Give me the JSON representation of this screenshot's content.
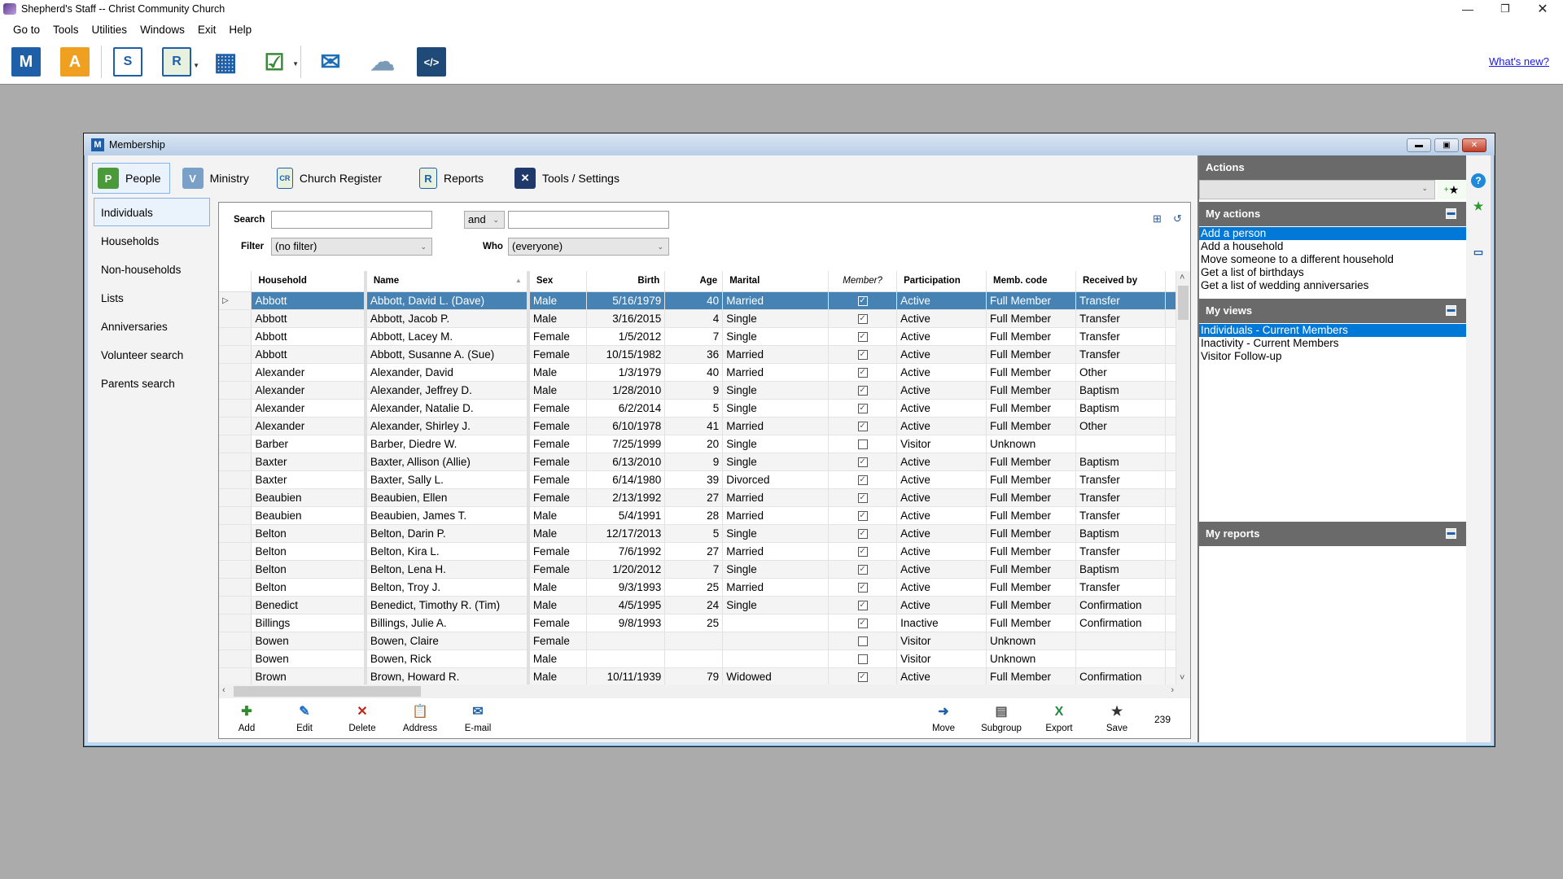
{
  "app": {
    "title": "Shepherd's Staff -- Christ Community Church",
    "menu": [
      "Go to",
      "Tools",
      "Utilities",
      "Windows",
      "Exit",
      "Help"
    ],
    "whats_new": "What's new?",
    "toolbar": [
      {
        "icon": "membership-icon",
        "glyph": "M"
      },
      {
        "icon": "attendance-icon",
        "glyph": "A"
      },
      {
        "icon": "staff-icon",
        "glyph": "S"
      },
      {
        "icon": "reports-icon",
        "glyph": "R"
      },
      {
        "icon": "calendar-icon",
        "glyph": "▦"
      },
      {
        "icon": "tasks-icon",
        "glyph": "☑"
      },
      {
        "icon": "email-icon",
        "glyph": "✉"
      },
      {
        "icon": "cloud-alert-icon",
        "glyph": "☁"
      },
      {
        "icon": "code-icon",
        "glyph": "</>"
      }
    ]
  },
  "membership": {
    "title": "Membership",
    "tabs": [
      {
        "label": "People",
        "glyph": "P",
        "active": true
      },
      {
        "label": "Ministry",
        "glyph": "V"
      },
      {
        "label": "Church Register",
        "glyph": "CR"
      },
      {
        "label": "Reports",
        "glyph": "R"
      },
      {
        "label": "Tools / Settings",
        "glyph": "✕"
      }
    ],
    "nav": [
      "Individuals",
      "Households",
      "Non-households",
      "Lists",
      "Anniversaries",
      "Volunteer search",
      "Parents search"
    ],
    "nav_active": 0,
    "search": {
      "search_label": "Search",
      "search_value": "",
      "conjunction": "and",
      "search2_value": "",
      "filter_label": "Filter",
      "filter_value": "(no filter)",
      "who_label": "Who",
      "who_value": "(everyone)"
    },
    "columns": [
      "Household",
      "Name",
      "Sex",
      "Birth",
      "Age",
      "Marital",
      "Member?",
      "Participation",
      "Memb. code",
      "Received by"
    ],
    "rows": [
      [
        "Abbott",
        "Abbott, David L. (Dave)",
        "Male",
        "5/16/1979",
        "40",
        "Married",
        true,
        "Active",
        "Full Member",
        "Transfer"
      ],
      [
        "Abbott",
        "Abbott, Jacob P.",
        "Male",
        "3/16/2015",
        "4",
        "Single",
        true,
        "Active",
        "Full Member",
        "Transfer"
      ],
      [
        "Abbott",
        "Abbott, Lacey M.",
        "Female",
        "1/5/2012",
        "7",
        "Single",
        true,
        "Active",
        "Full Member",
        "Transfer"
      ],
      [
        "Abbott",
        "Abbott, Susanne A. (Sue)",
        "Female",
        "10/15/1982",
        "36",
        "Married",
        true,
        "Active",
        "Full Member",
        "Transfer"
      ],
      [
        "Alexander",
        "Alexander, David",
        "Male",
        "1/3/1979",
        "40",
        "Married",
        true,
        "Active",
        "Full Member",
        "Other"
      ],
      [
        "Alexander",
        "Alexander, Jeffrey D.",
        "Male",
        "1/28/2010",
        "9",
        "Single",
        true,
        "Active",
        "Full Member",
        "Baptism"
      ],
      [
        "Alexander",
        "Alexander, Natalie D.",
        "Female",
        "6/2/2014",
        "5",
        "Single",
        true,
        "Active",
        "Full Member",
        "Baptism"
      ],
      [
        "Alexander",
        "Alexander, Shirley J.",
        "Female",
        "6/10/1978",
        "41",
        "Married",
        true,
        "Active",
        "Full Member",
        "Other"
      ],
      [
        "Barber",
        "Barber, Diedre W.",
        "Female",
        "7/25/1999",
        "20",
        "Single",
        false,
        "Visitor",
        "Unknown",
        ""
      ],
      [
        "Baxter",
        "Baxter, Allison (Allie)",
        "Female",
        "6/13/2010",
        "9",
        "Single",
        true,
        "Active",
        "Full Member",
        "Baptism"
      ],
      [
        "Baxter",
        "Baxter, Sally L.",
        "Female",
        "6/14/1980",
        "39",
        "Divorced",
        true,
        "Active",
        "Full Member",
        "Transfer"
      ],
      [
        "Beaubien",
        "Beaubien, Ellen",
        "Female",
        "2/13/1992",
        "27",
        "Married",
        true,
        "Active",
        "Full Member",
        "Transfer"
      ],
      [
        "Beaubien",
        "Beaubien, James T.",
        "Male",
        "5/4/1991",
        "28",
        "Married",
        true,
        "Active",
        "Full Member",
        "Transfer"
      ],
      [
        "Belton",
        "Belton, Darin P.",
        "Male",
        "12/17/2013",
        "5",
        "Single",
        true,
        "Active",
        "Full Member",
        "Baptism"
      ],
      [
        "Belton",
        "Belton, Kira L.",
        "Female",
        "7/6/1992",
        "27",
        "Married",
        true,
        "Active",
        "Full Member",
        "Transfer"
      ],
      [
        "Belton",
        "Belton, Lena H.",
        "Female",
        "1/20/2012",
        "7",
        "Single",
        true,
        "Active",
        "Full Member",
        "Baptism"
      ],
      [
        "Belton",
        "Belton, Troy J.",
        "Male",
        "9/3/1993",
        "25",
        "Married",
        true,
        "Active",
        "Full Member",
        "Transfer"
      ],
      [
        "Benedict",
        "Benedict, Timothy R. (Tim)",
        "Male",
        "4/5/1995",
        "24",
        "Single",
        true,
        "Active",
        "Full Member",
        "Confirmation"
      ],
      [
        "Billings",
        "Billings, Julie A.",
        "Female",
        "9/8/1993",
        "25",
        "",
        true,
        "Inactive",
        "Full Member",
        "Confirmation"
      ],
      [
        "Bowen",
        "Bowen, Claire",
        "Female",
        "",
        "",
        "",
        false,
        "Visitor",
        "Unknown",
        ""
      ],
      [
        "Bowen",
        "Bowen, Rick",
        "Male",
        "",
        "",
        "",
        false,
        "Visitor",
        "Unknown",
        ""
      ],
      [
        "Brown",
        "Brown, Howard R.",
        "Male",
        "10/11/1939",
        "79",
        "Widowed",
        true,
        "Active",
        "Full Member",
        "Confirmation"
      ]
    ],
    "selected_row": 0,
    "footer_buttons_left": [
      {
        "label": "Add",
        "glyph": "✚",
        "color": "#2e8b2e",
        "icon": "add-icon"
      },
      {
        "label": "Edit",
        "glyph": "✎",
        "color": "#1f6fc8",
        "icon": "pencil-icon"
      },
      {
        "label": "Delete",
        "glyph": "✕",
        "color": "#c0281e",
        "icon": "delete-icon"
      },
      {
        "label": "Address",
        "glyph": "📋",
        "color": "#555555",
        "icon": "address-icon"
      },
      {
        "label": "E-mail",
        "glyph": "✉",
        "color": "#1f5fa8",
        "icon": "email-icon"
      }
    ],
    "footer_buttons_right": [
      {
        "label": "Move",
        "glyph": "➜",
        "color": "#1f5fa8",
        "icon": "move-icon"
      },
      {
        "label": "Subgroup",
        "glyph": "▤",
        "color": "#555555",
        "icon": "subgroup-icon"
      },
      {
        "label": "Export",
        "glyph": "X",
        "color": "#1f8a3e",
        "icon": "excel-export-icon"
      },
      {
        "label": "Save",
        "glyph": "★",
        "color": "#333333",
        "icon": "save-star-icon"
      }
    ],
    "record_count": "239"
  },
  "actions_panel": {
    "title": "Actions",
    "combo_value": "",
    "my_actions_title": "My actions",
    "my_actions": [
      "Add a person",
      "Add a household",
      "Move someone to a different household",
      "Get a list of birthdays",
      "Get a list of wedding anniversaries"
    ],
    "my_actions_selected": 0,
    "my_views_title": "My views",
    "my_views": [
      "Individuals - Current Members",
      "Inactivity - Current Members",
      "Visitor Follow-up"
    ],
    "my_views_selected": 0,
    "my_reports_title": "My reports",
    "my_reports": []
  },
  "colors": {
    "selection_row": "#4682b4",
    "selection_list": "#0078d7",
    "panel_header": "#6a6a6a",
    "link": "#1a1ae6"
  }
}
